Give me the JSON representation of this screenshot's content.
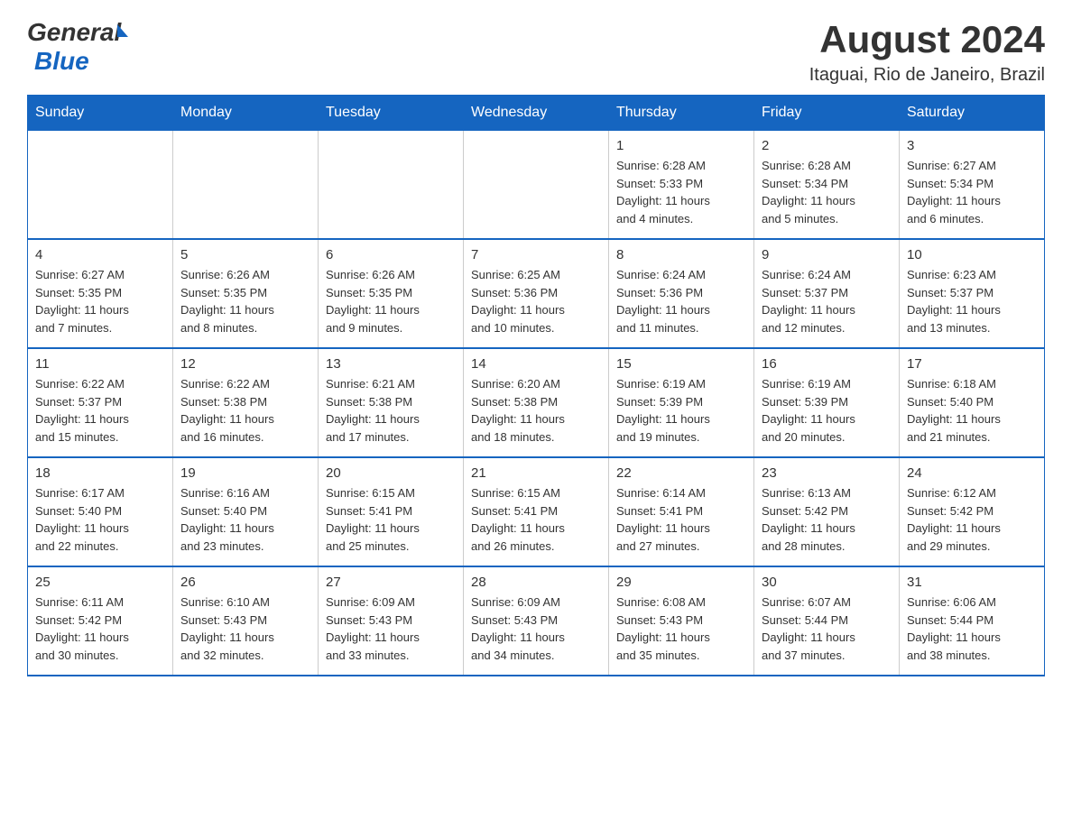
{
  "logo": {
    "general": "General",
    "blue": "Blue"
  },
  "title": "August 2024",
  "location": "Itaguai, Rio de Janeiro, Brazil",
  "days_of_week": [
    "Sunday",
    "Monday",
    "Tuesday",
    "Wednesday",
    "Thursday",
    "Friday",
    "Saturday"
  ],
  "weeks": [
    [
      {
        "day": "",
        "info": ""
      },
      {
        "day": "",
        "info": ""
      },
      {
        "day": "",
        "info": ""
      },
      {
        "day": "",
        "info": ""
      },
      {
        "day": "1",
        "info": "Sunrise: 6:28 AM\nSunset: 5:33 PM\nDaylight: 11 hours\nand 4 minutes."
      },
      {
        "day": "2",
        "info": "Sunrise: 6:28 AM\nSunset: 5:34 PM\nDaylight: 11 hours\nand 5 minutes."
      },
      {
        "day": "3",
        "info": "Sunrise: 6:27 AM\nSunset: 5:34 PM\nDaylight: 11 hours\nand 6 minutes."
      }
    ],
    [
      {
        "day": "4",
        "info": "Sunrise: 6:27 AM\nSunset: 5:35 PM\nDaylight: 11 hours\nand 7 minutes."
      },
      {
        "day": "5",
        "info": "Sunrise: 6:26 AM\nSunset: 5:35 PM\nDaylight: 11 hours\nand 8 minutes."
      },
      {
        "day": "6",
        "info": "Sunrise: 6:26 AM\nSunset: 5:35 PM\nDaylight: 11 hours\nand 9 minutes."
      },
      {
        "day": "7",
        "info": "Sunrise: 6:25 AM\nSunset: 5:36 PM\nDaylight: 11 hours\nand 10 minutes."
      },
      {
        "day": "8",
        "info": "Sunrise: 6:24 AM\nSunset: 5:36 PM\nDaylight: 11 hours\nand 11 minutes."
      },
      {
        "day": "9",
        "info": "Sunrise: 6:24 AM\nSunset: 5:37 PM\nDaylight: 11 hours\nand 12 minutes."
      },
      {
        "day": "10",
        "info": "Sunrise: 6:23 AM\nSunset: 5:37 PM\nDaylight: 11 hours\nand 13 minutes."
      }
    ],
    [
      {
        "day": "11",
        "info": "Sunrise: 6:22 AM\nSunset: 5:37 PM\nDaylight: 11 hours\nand 15 minutes."
      },
      {
        "day": "12",
        "info": "Sunrise: 6:22 AM\nSunset: 5:38 PM\nDaylight: 11 hours\nand 16 minutes."
      },
      {
        "day": "13",
        "info": "Sunrise: 6:21 AM\nSunset: 5:38 PM\nDaylight: 11 hours\nand 17 minutes."
      },
      {
        "day": "14",
        "info": "Sunrise: 6:20 AM\nSunset: 5:38 PM\nDaylight: 11 hours\nand 18 minutes."
      },
      {
        "day": "15",
        "info": "Sunrise: 6:19 AM\nSunset: 5:39 PM\nDaylight: 11 hours\nand 19 minutes."
      },
      {
        "day": "16",
        "info": "Sunrise: 6:19 AM\nSunset: 5:39 PM\nDaylight: 11 hours\nand 20 minutes."
      },
      {
        "day": "17",
        "info": "Sunrise: 6:18 AM\nSunset: 5:40 PM\nDaylight: 11 hours\nand 21 minutes."
      }
    ],
    [
      {
        "day": "18",
        "info": "Sunrise: 6:17 AM\nSunset: 5:40 PM\nDaylight: 11 hours\nand 22 minutes."
      },
      {
        "day": "19",
        "info": "Sunrise: 6:16 AM\nSunset: 5:40 PM\nDaylight: 11 hours\nand 23 minutes."
      },
      {
        "day": "20",
        "info": "Sunrise: 6:15 AM\nSunset: 5:41 PM\nDaylight: 11 hours\nand 25 minutes."
      },
      {
        "day": "21",
        "info": "Sunrise: 6:15 AM\nSunset: 5:41 PM\nDaylight: 11 hours\nand 26 minutes."
      },
      {
        "day": "22",
        "info": "Sunrise: 6:14 AM\nSunset: 5:41 PM\nDaylight: 11 hours\nand 27 minutes."
      },
      {
        "day": "23",
        "info": "Sunrise: 6:13 AM\nSunset: 5:42 PM\nDaylight: 11 hours\nand 28 minutes."
      },
      {
        "day": "24",
        "info": "Sunrise: 6:12 AM\nSunset: 5:42 PM\nDaylight: 11 hours\nand 29 minutes."
      }
    ],
    [
      {
        "day": "25",
        "info": "Sunrise: 6:11 AM\nSunset: 5:42 PM\nDaylight: 11 hours\nand 30 minutes."
      },
      {
        "day": "26",
        "info": "Sunrise: 6:10 AM\nSunset: 5:43 PM\nDaylight: 11 hours\nand 32 minutes."
      },
      {
        "day": "27",
        "info": "Sunrise: 6:09 AM\nSunset: 5:43 PM\nDaylight: 11 hours\nand 33 minutes."
      },
      {
        "day": "28",
        "info": "Sunrise: 6:09 AM\nSunset: 5:43 PM\nDaylight: 11 hours\nand 34 minutes."
      },
      {
        "day": "29",
        "info": "Sunrise: 6:08 AM\nSunset: 5:43 PM\nDaylight: 11 hours\nand 35 minutes."
      },
      {
        "day": "30",
        "info": "Sunrise: 6:07 AM\nSunset: 5:44 PM\nDaylight: 11 hours\nand 37 minutes."
      },
      {
        "day": "31",
        "info": "Sunrise: 6:06 AM\nSunset: 5:44 PM\nDaylight: 11 hours\nand 38 minutes."
      }
    ]
  ]
}
